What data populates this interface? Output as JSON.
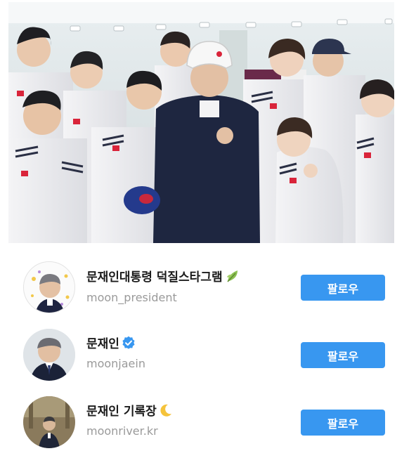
{
  "accounts": [
    {
      "name": "문재인대통령 덕질스타그램",
      "name_emoji": "leaf-icon",
      "handle": "moon_president",
      "follow_label": "팔로우"
    },
    {
      "name": "문재인",
      "name_emoji": "verified-badge-icon",
      "handle": "moonjaein",
      "follow_label": "팔로우"
    },
    {
      "name": "문재인 기록장",
      "name_emoji": "crescent-moon-icon",
      "handle": "moonriver.kr",
      "follow_label": "팔로우"
    }
  ],
  "colors": {
    "follow_button": "#3897f0",
    "verified_badge": "#3897f0",
    "handle_text": "#9a9a9a",
    "name_text": "#1b1b1b"
  }
}
